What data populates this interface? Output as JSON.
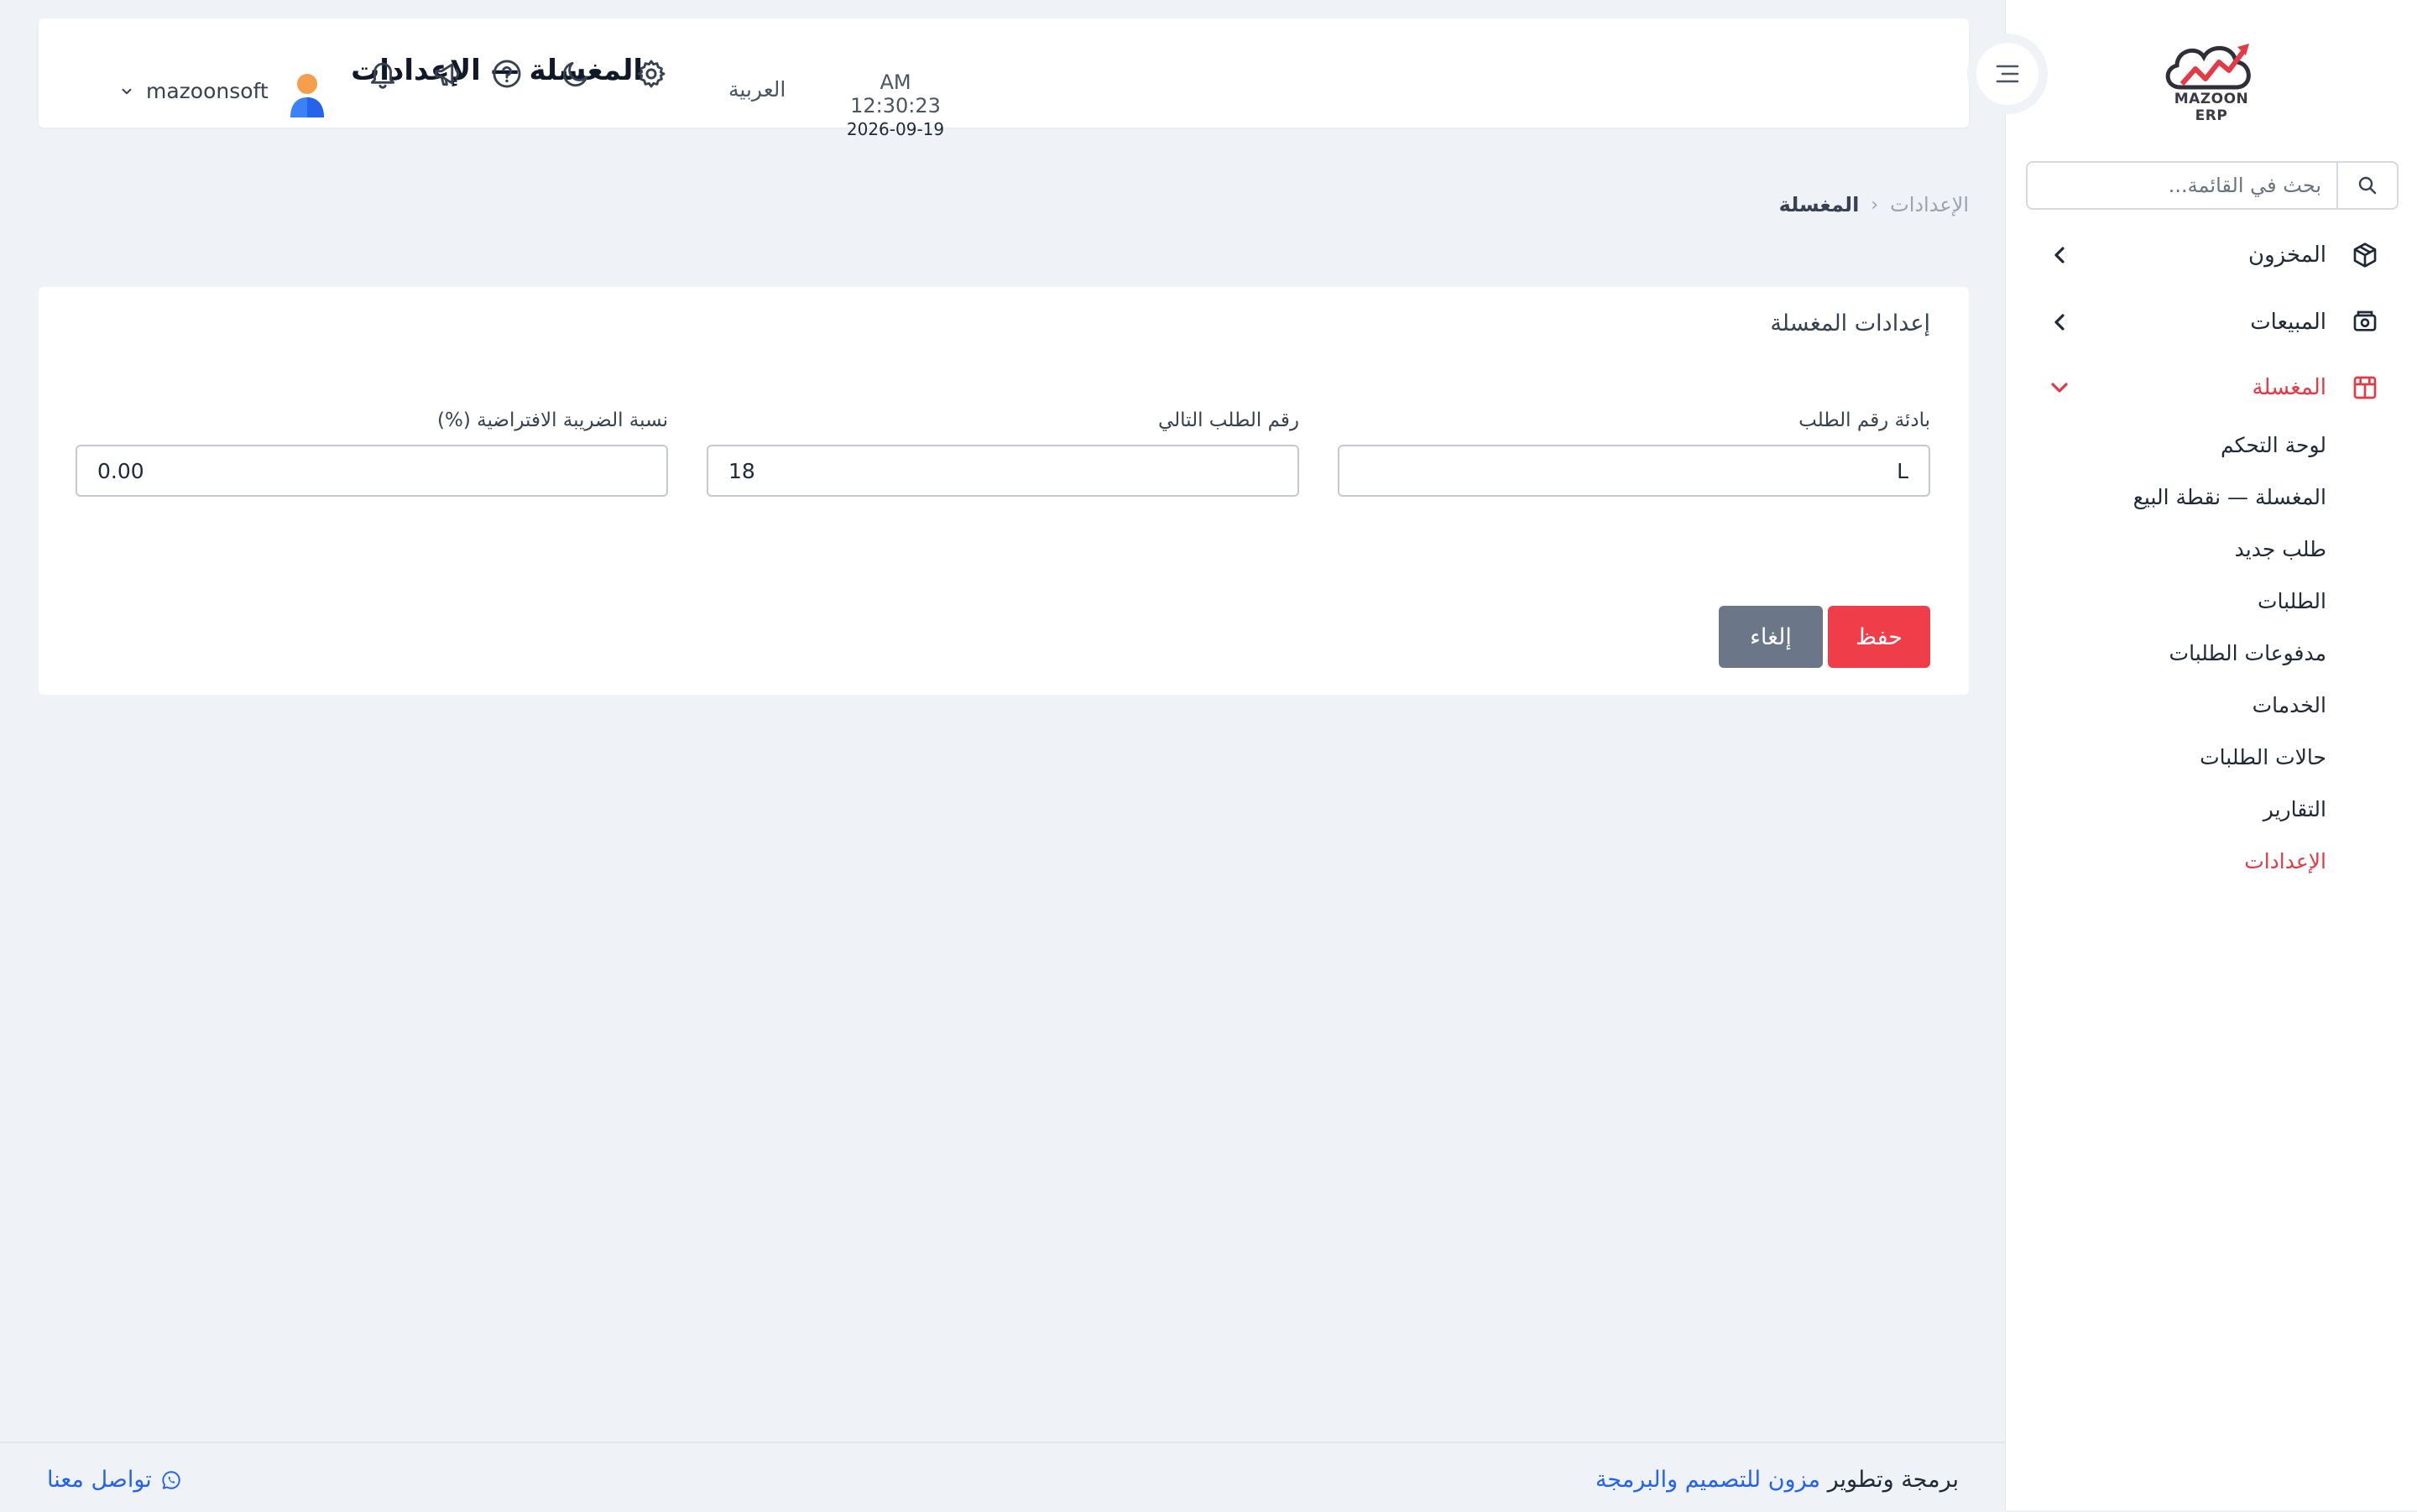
{
  "brand": {
    "logo_text": "MAZOON ERP",
    "logo_small_text": "ERP"
  },
  "sidebar": {
    "search_placeholder": "بحث في القائمة...",
    "menu": [
      {
        "label": "المخزون",
        "icon": "box-icon",
        "expanded": false
      },
      {
        "label": "المبيعات",
        "icon": "cash-register-icon",
        "expanded": false
      },
      {
        "label": "المغسلة",
        "icon": "laundry-icon",
        "expanded": true,
        "active": true
      }
    ],
    "submenu": [
      "لوحة التحكم",
      "المغسلة — نقطة البيع",
      "طلب جديد",
      "الطلبات",
      "مدفوعات الطلبات",
      "الخدمات",
      "حالات الطلبات",
      "التقارير",
      "الإعدادات"
    ],
    "active_submenu_index": 8
  },
  "header": {
    "title": "المغسلة — الإعدادات",
    "time": "AM 12:30:23",
    "date": "2026-09-19",
    "language": "العربية",
    "username": "mazoonsoft",
    "icons": [
      "settings-icon",
      "dark-mode-icon",
      "help-icon",
      "announcement-icon",
      "notification-bell-icon"
    ]
  },
  "breadcrumb": {
    "root": "المغسلة",
    "separator": "‹",
    "current": "الإعدادات"
  },
  "settings_card": {
    "title": "إعدادات المغسلة",
    "fields": [
      {
        "label": "بادئة رقم الطلب",
        "value": "L"
      },
      {
        "label": "رقم الطلب التالي",
        "value": "18"
      },
      {
        "label": "نسبة الضريبة الافتراضية (%)",
        "value": "0.00"
      }
    ],
    "save_label": "حفظ",
    "cancel_label": "إلغاء"
  },
  "footer": {
    "credit_text": "برمجة وتطوير",
    "credit_link": "مزون للتصميم والبرمجة",
    "contact": "تواصل معنا"
  },
  "colors": {
    "accent_red": "#ef3e4a",
    "active_text": "#e53946",
    "cancel_gray": "#6b7688",
    "link_blue": "#2563eb",
    "page_bg": "#eff2f6"
  }
}
